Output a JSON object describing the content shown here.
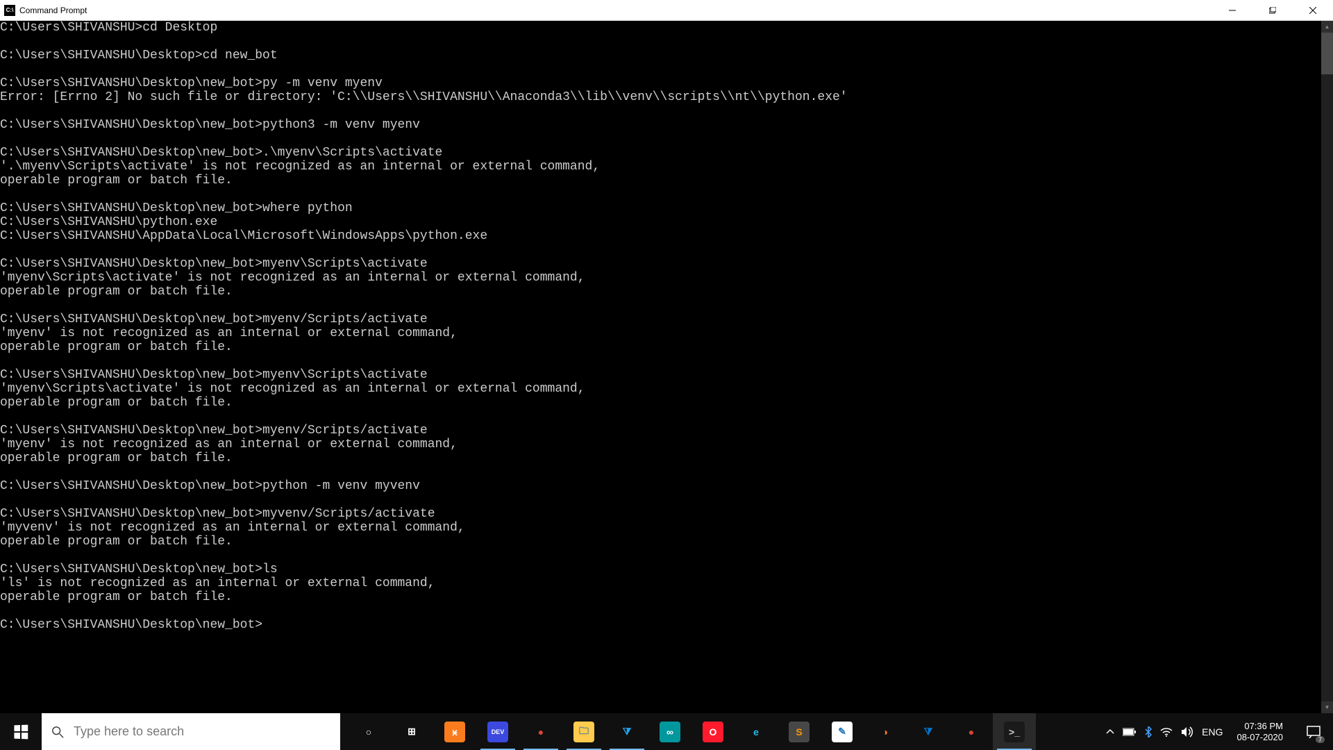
{
  "window": {
    "title": "Command Prompt",
    "icon_text": "C:\\"
  },
  "terminal": {
    "lines": [
      "C:\\Users\\SHIVANSHU>cd Desktop",
      "",
      "C:\\Users\\SHIVANSHU\\Desktop>cd new_bot",
      "",
      "C:\\Users\\SHIVANSHU\\Desktop\\new_bot>py -m venv myenv",
      "Error: [Errno 2] No such file or directory: 'C:\\\\Users\\\\SHIVANSHU\\\\Anaconda3\\\\lib\\\\venv\\\\scripts\\\\nt\\\\python.exe'",
      "",
      "C:\\Users\\SHIVANSHU\\Desktop\\new_bot>python3 -m venv myenv",
      "",
      "C:\\Users\\SHIVANSHU\\Desktop\\new_bot>.\\myenv\\Scripts\\activate",
      "'.\\myenv\\Scripts\\activate' is not recognized as an internal or external command,",
      "operable program or batch file.",
      "",
      "C:\\Users\\SHIVANSHU\\Desktop\\new_bot>where python",
      "C:\\Users\\SHIVANSHU\\python.exe",
      "C:\\Users\\SHIVANSHU\\AppData\\Local\\Microsoft\\WindowsApps\\python.exe",
      "",
      "C:\\Users\\SHIVANSHU\\Desktop\\new_bot>myenv\\Scripts\\activate",
      "'myenv\\Scripts\\activate' is not recognized as an internal or external command,",
      "operable program or batch file.",
      "",
      "C:\\Users\\SHIVANSHU\\Desktop\\new_bot>myenv/Scripts/activate",
      "'myenv' is not recognized as an internal or external command,",
      "operable program or batch file.",
      "",
      "C:\\Users\\SHIVANSHU\\Desktop\\new_bot>myenv\\Scripts\\activate",
      "'myenv\\Scripts\\activate' is not recognized as an internal or external command,",
      "operable program or batch file.",
      "",
      "C:\\Users\\SHIVANSHU\\Desktop\\new_bot>myenv/Scripts/activate",
      "'myenv' is not recognized as an internal or external command,",
      "operable program or batch file.",
      "",
      "C:\\Users\\SHIVANSHU\\Desktop\\new_bot>python -m venv myvenv",
      "",
      "C:\\Users\\SHIVANSHU\\Desktop\\new_bot>myvenv/Scripts/activate",
      "'myvenv' is not recognized as an internal or external command,",
      "operable program or batch file.",
      "",
      "C:\\Users\\SHIVANSHU\\Desktop\\new_bot>ls",
      "'ls' is not recognized as an internal or external command,",
      "operable program or batch file.",
      "",
      "C:\\Users\\SHIVANSHU\\Desktop\\new_bot>"
    ]
  },
  "taskbar": {
    "search_placeholder": "Type here to search",
    "apps": [
      {
        "name": "cortana",
        "glyph": "○",
        "bg": "transparent",
        "color": "#fff"
      },
      {
        "name": "task-view",
        "glyph": "⊞",
        "bg": "transparent",
        "color": "#fff"
      },
      {
        "name": "xampp",
        "glyph": "ӿ",
        "bg": "#fb7c1e",
        "color": "#fff"
      },
      {
        "name": "dev",
        "glyph": "DEV",
        "bg": "#3b49df",
        "color": "#fff",
        "active": true
      },
      {
        "name": "chrome1",
        "glyph": "●",
        "bg": "transparent",
        "color": "#db4437",
        "active": true
      },
      {
        "name": "file-explorer",
        "glyph": "🗀",
        "bg": "#ffcc4d",
        "color": "#3a6ea5",
        "active": true
      },
      {
        "name": "vscode1",
        "glyph": "⧩",
        "bg": "transparent",
        "color": "#22a6f1",
        "active": true
      },
      {
        "name": "arduino",
        "glyph": "∞",
        "bg": "#00979d",
        "color": "#fff"
      },
      {
        "name": "opera",
        "glyph": "O",
        "bg": "#ff1b2d",
        "color": "#fff"
      },
      {
        "name": "ie",
        "glyph": "e",
        "bg": "transparent",
        "color": "#1ebbee"
      },
      {
        "name": "sublime",
        "glyph": "S",
        "bg": "#474747",
        "color": "#ff9800"
      },
      {
        "name": "notepad",
        "glyph": "✎",
        "bg": "#fff",
        "color": "#2a7ab9"
      },
      {
        "name": "jupyter",
        "glyph": "◑",
        "bg": "transparent",
        "color": "#f37626"
      },
      {
        "name": "vscode2",
        "glyph": "⧩",
        "bg": "transparent",
        "color": "#0078d7"
      },
      {
        "name": "chrome2",
        "glyph": "●",
        "bg": "transparent",
        "color": "#db4437"
      },
      {
        "name": "cmd",
        "glyph": ">_",
        "bg": "#1a1a1a",
        "color": "#ccc",
        "active": true,
        "running_bg": true
      }
    ],
    "tray": {
      "lang": "ENG",
      "time": "07:36 PM",
      "date": "08-07-2020",
      "notif_count": "7"
    }
  }
}
